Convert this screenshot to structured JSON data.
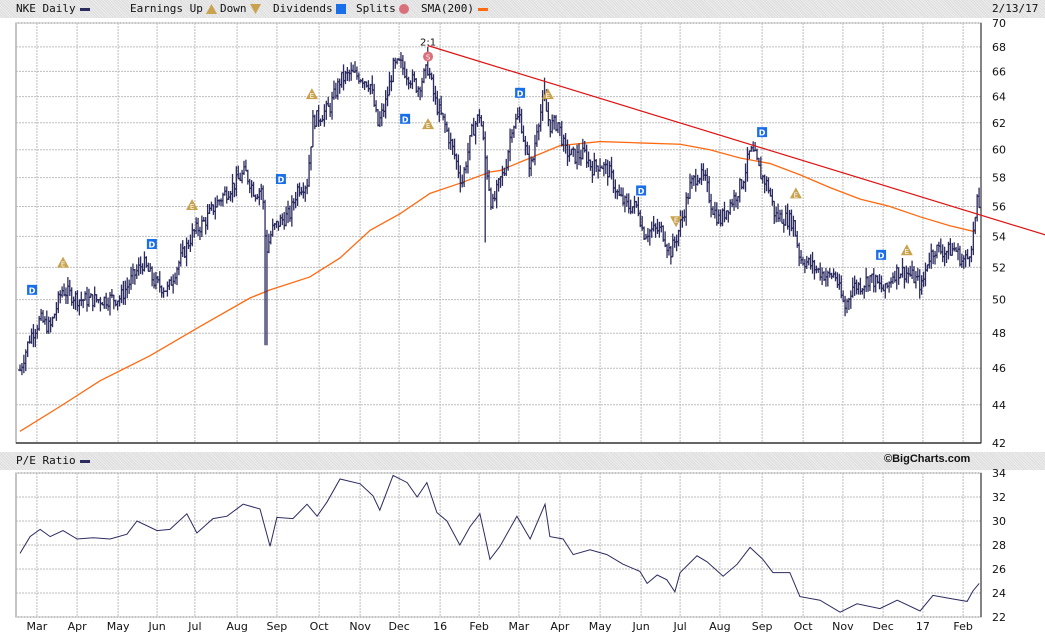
{
  "header": {
    "symbol_label": "NKE Daily",
    "earnings_label": "Earnings Up",
    "down_label": "Down",
    "dividends_label": "Dividends",
    "splits_label": "Splits",
    "sma_label": "SMA(200)",
    "date": "2/13/17"
  },
  "pe_header": {
    "label": "P/E Ratio",
    "brand": "©BigCharts.com"
  },
  "colors": {
    "price": "#2b2b60",
    "sma": "#ff6a10",
    "trend": "#e01010",
    "dividend": "#1a6ee8",
    "earnings": "#c9a24e",
    "split": "#d9707a",
    "grid": "#bdbdbd"
  },
  "chart_data": [
    {
      "type": "line",
      "title": "NKE Daily",
      "x_unit": "months since 2/13/15",
      "yscale": "log",
      "ylim": [
        42,
        70
      ],
      "yticks": [
        "42",
        "44",
        "46",
        "48",
        "50",
        "52",
        "54",
        "56",
        "58",
        "60",
        "62",
        "64",
        "66",
        "68",
        "70"
      ],
      "xticks": [
        {
          "t": 0.52,
          "label": "Mar"
        },
        {
          "t": 1.52,
          "label": "Apr"
        },
        {
          "t": 2.54,
          "label": "May"
        },
        {
          "t": 3.51,
          "label": "Jun"
        },
        {
          "t": 4.45,
          "label": "Jul"
        },
        {
          "t": 5.5,
          "label": "Aug"
        },
        {
          "t": 6.49,
          "label": "Sep"
        },
        {
          "t": 7.54,
          "label": "Oct"
        },
        {
          "t": 8.56,
          "label": "Nov"
        },
        {
          "t": 9.53,
          "label": "Dec"
        },
        {
          "t": 10.55,
          "label": "16"
        },
        {
          "t": 11.52,
          "label": "Feb"
        },
        {
          "t": 12.51,
          "label": "Mar"
        },
        {
          "t": 13.53,
          "label": "Apr"
        },
        {
          "t": 14.53,
          "label": "May"
        },
        {
          "t": 15.55,
          "label": "Jun"
        },
        {
          "t": 16.52,
          "label": "Jul"
        },
        {
          "t": 17.51,
          "label": "Aug"
        },
        {
          "t": 18.56,
          "label": "Sep"
        },
        {
          "t": 19.58,
          "label": "Oct"
        },
        {
          "t": 20.57,
          "label": "Nov"
        },
        {
          "t": 21.57,
          "label": "Dec"
        },
        {
          "t": 22.56,
          "label": "17"
        },
        {
          "t": 23.56,
          "label": "Feb"
        }
      ],
      "grid": true,
      "series_price_close": [
        [
          0.1,
          45.9
        ],
        [
          0.35,
          47.8
        ],
        [
          0.6,
          48.8
        ],
        [
          0.85,
          48.3
        ],
        [
          1.14,
          50.6
        ],
        [
          1.59,
          50.0
        ],
        [
          2.09,
          50.0
        ],
        [
          2.59,
          50.1
        ],
        [
          2.91,
          51.4
        ],
        [
          3.16,
          52.3
        ],
        [
          3.46,
          51.0
        ],
        [
          3.78,
          50.6
        ],
        [
          3.96,
          51.8
        ],
        [
          4.2,
          53.1
        ],
        [
          4.4,
          54.2
        ],
        [
          4.7,
          55.0
        ],
        [
          4.95,
          56.1
        ],
        [
          5.2,
          56.9
        ],
        [
          5.45,
          57.6
        ],
        [
          5.7,
          58.4
        ],
        [
          5.95,
          56.9
        ],
        [
          6.12,
          57.3
        ],
        [
          6.22,
          53.0
        ],
        [
          6.37,
          54.4
        ],
        [
          6.57,
          55.0
        ],
        [
          6.82,
          55.5
        ],
        [
          7.01,
          57.3
        ],
        [
          7.24,
          57.6
        ],
        [
          7.39,
          62.2
        ],
        [
          7.56,
          62.5
        ],
        [
          7.81,
          63.2
        ],
        [
          8.06,
          65.3
        ],
        [
          8.31,
          65.8
        ],
        [
          8.56,
          65.6
        ],
        [
          8.81,
          65.0
        ],
        [
          9.0,
          61.8
        ],
        [
          9.18,
          63.3
        ],
        [
          9.38,
          66.3
        ],
        [
          9.55,
          66.6
        ],
        [
          9.75,
          65.7
        ],
        [
          10.0,
          64.7
        ],
        [
          10.25,
          66.3
        ],
        [
          10.42,
          63.7
        ],
        [
          10.67,
          61.8
        ],
        [
          10.92,
          59.5
        ],
        [
          11.09,
          57.6
        ],
        [
          11.34,
          61.3
        ],
        [
          11.54,
          62.7
        ],
        [
          11.67,
          59.4
        ],
        [
          11.84,
          55.9
        ],
        [
          12.04,
          57.8
        ],
        [
          12.16,
          58.5
        ],
        [
          12.34,
          61.8
        ],
        [
          12.54,
          62.5
        ],
        [
          12.71,
          59.3
        ],
        [
          12.84,
          58.8
        ],
        [
          12.96,
          61.8
        ],
        [
          13.13,
          63.7
        ],
        [
          13.28,
          61.8
        ],
        [
          13.48,
          62.0
        ],
        [
          13.66,
          59.9
        ],
        [
          13.91,
          59.5
        ],
        [
          14.15,
          59.7
        ],
        [
          14.33,
          58.7
        ],
        [
          14.53,
          59.0
        ],
        [
          14.78,
          58.3
        ],
        [
          14.98,
          56.7
        ],
        [
          15.22,
          56.0
        ],
        [
          15.47,
          56.0
        ],
        [
          15.6,
          54.2
        ],
        [
          15.82,
          54.4
        ],
        [
          16.07,
          54.4
        ],
        [
          16.27,
          52.9
        ],
        [
          16.44,
          54.0
        ],
        [
          16.59,
          55.4
        ],
        [
          16.77,
          57.4
        ],
        [
          16.97,
          58.3
        ],
        [
          17.14,
          57.8
        ],
        [
          17.31,
          56.0
        ],
        [
          17.51,
          55.0
        ],
        [
          17.71,
          56.0
        ],
        [
          17.89,
          56.7
        ],
        [
          18.08,
          57.8
        ],
        [
          18.26,
          59.9
        ],
        [
          18.38,
          59.5
        ],
        [
          18.51,
          58.3
        ],
        [
          18.71,
          57.4
        ],
        [
          18.88,
          55.4
        ],
        [
          19.13,
          55.2
        ],
        [
          19.33,
          55.0
        ],
        [
          19.5,
          52.6
        ],
        [
          19.7,
          52.3
        ],
        [
          19.95,
          51.8
        ],
        [
          20.2,
          51.4
        ],
        [
          20.37,
          51.6
        ],
        [
          20.5,
          50.4
        ],
        [
          20.62,
          49.5
        ],
        [
          20.8,
          50.8
        ],
        [
          21.04,
          50.9
        ],
        [
          21.24,
          51.4
        ],
        [
          21.49,
          50.8
        ],
        [
          21.62,
          50.5
        ],
        [
          21.82,
          51.6
        ],
        [
          21.99,
          51.8
        ],
        [
          22.19,
          51.6
        ],
        [
          22.36,
          51.3
        ],
        [
          22.54,
          50.8
        ],
        [
          22.69,
          52.6
        ],
        [
          22.86,
          53.2
        ],
        [
          23.11,
          53.0
        ],
        [
          23.36,
          53.2
        ],
        [
          23.53,
          52.4
        ],
        [
          23.68,
          52.6
        ],
        [
          23.81,
          54.1
        ],
        [
          23.91,
          56.2
        ],
        [
          23.98,
          55.9
        ]
      ],
      "price_extremes": [
        {
          "t": 6.22,
          "low": 47.3
        },
        {
          "t": 10.25,
          "high": 68.0
        },
        {
          "t": 11.67,
          "low": 53.6
        },
        {
          "t": 13.13,
          "high": 65.5
        },
        {
          "t": 20.62,
          "low": 49.0
        }
      ],
      "series_sma200": [
        [
          0.1,
          42.6
        ],
        [
          1.09,
          43.9
        ],
        [
          2.09,
          45.3
        ],
        [
          3.33,
          46.7
        ],
        [
          4.58,
          48.4
        ],
        [
          5.82,
          50.1
        ],
        [
          6.32,
          50.6
        ],
        [
          7.31,
          51.4
        ],
        [
          8.06,
          52.6
        ],
        [
          8.81,
          54.4
        ],
        [
          9.55,
          55.5
        ],
        [
          10.3,
          56.9
        ],
        [
          11.04,
          57.6
        ],
        [
          11.79,
          58.4
        ],
        [
          12.04,
          58.5
        ],
        [
          12.79,
          59.4
        ],
        [
          13.53,
          60.3
        ],
        [
          14.53,
          60.6
        ],
        [
          15.52,
          60.5
        ],
        [
          16.52,
          60.4
        ],
        [
          17.26,
          60.0
        ],
        [
          18.01,
          59.4
        ],
        [
          18.76,
          59.0
        ],
        [
          19.5,
          58.2
        ],
        [
          20.25,
          57.3
        ],
        [
          21.0,
          56.5
        ],
        [
          21.74,
          56.0
        ],
        [
          22.49,
          55.3
        ],
        [
          23.23,
          54.7
        ],
        [
          23.86,
          54.3
        ]
      ],
      "trendline": {
        "start": {
          "t": 10.25,
          "price": 68.1
        },
        "end": {
          "t": 25.6,
          "price": 54.1
        }
      },
      "dividends": [
        {
          "t": 0.4,
          "price": 50.6
        },
        {
          "t": 3.38,
          "price": 53.5
        },
        {
          "t": 6.59,
          "price": 57.9
        },
        {
          "t": 9.68,
          "price": 62.3
        },
        {
          "t": 12.54,
          "price": 64.3
        },
        {
          "t": 15.55,
          "price": 57.1
        },
        {
          "t": 18.56,
          "price": 61.3
        },
        {
          "t": 21.52,
          "price": 52.8
        }
      ],
      "earnings_up": [
        {
          "t": 1.17,
          "price": 52.3
        },
        {
          "t": 4.38,
          "price": 56.1
        },
        {
          "t": 7.36,
          "price": 64.2
        },
        {
          "t": 10.25,
          "price": 61.9
        },
        {
          "t": 13.23,
          "price": 64.2
        },
        {
          "t": 19.4,
          "price": 56.9
        },
        {
          "t": 22.16,
          "price": 53.1
        }
      ],
      "earnings_down": [
        {
          "t": 16.42,
          "price": 55.0
        }
      ],
      "splits": [
        {
          "t": 10.25,
          "price": 67.2,
          "label": "2:1"
        }
      ],
      "marker_glyphs": {
        "dividend": "D",
        "earnings": "E",
        "split": "S"
      }
    },
    {
      "type": "line",
      "title": "P/E Ratio",
      "ylim": [
        22,
        34
      ],
      "yticks": [
        "22",
        "24",
        "26",
        "28",
        "30",
        "32",
        "34"
      ],
      "grid": true,
      "series_pe": [
        [
          0.1,
          27.3
        ],
        [
          0.35,
          28.7
        ],
        [
          0.6,
          29.3
        ],
        [
          0.85,
          28.7
        ],
        [
          1.17,
          29.2
        ],
        [
          1.52,
          28.5
        ],
        [
          1.92,
          28.6
        ],
        [
          2.34,
          28.5
        ],
        [
          2.76,
          28.9
        ],
        [
          3.01,
          30.0
        ],
        [
          3.51,
          29.2
        ],
        [
          3.83,
          29.3
        ],
        [
          4.25,
          30.6
        ],
        [
          4.5,
          29.0
        ],
        [
          4.9,
          30.2
        ],
        [
          5.25,
          30.4
        ],
        [
          5.65,
          31.4
        ],
        [
          6.07,
          31.0
        ],
        [
          6.32,
          27.9
        ],
        [
          6.49,
          30.3
        ],
        [
          6.89,
          30.2
        ],
        [
          7.24,
          31.4
        ],
        [
          7.49,
          30.4
        ],
        [
          7.74,
          31.6
        ],
        [
          8.06,
          33.5
        ],
        [
          8.56,
          33.1
        ],
        [
          8.88,
          32.1
        ],
        [
          9.05,
          30.9
        ],
        [
          9.38,
          33.8
        ],
        [
          9.73,
          33.2
        ],
        [
          9.98,
          32.0
        ],
        [
          10.22,
          33.2
        ],
        [
          10.47,
          30.7
        ],
        [
          10.72,
          30.0
        ],
        [
          11.04,
          28.0
        ],
        [
          11.29,
          29.5
        ],
        [
          11.54,
          30.6
        ],
        [
          11.79,
          26.8
        ],
        [
          12.04,
          27.9
        ],
        [
          12.46,
          30.4
        ],
        [
          12.79,
          28.5
        ],
        [
          13.16,
          31.4
        ],
        [
          13.28,
          28.7
        ],
        [
          13.61,
          28.5
        ],
        [
          13.86,
          27.2
        ],
        [
          14.28,
          27.6
        ],
        [
          14.7,
          27.2
        ],
        [
          15.1,
          26.4
        ],
        [
          15.52,
          25.8
        ],
        [
          15.7,
          24.8
        ],
        [
          15.95,
          25.5
        ],
        [
          16.19,
          25.1
        ],
        [
          16.39,
          24.1
        ],
        [
          16.52,
          25.7
        ],
        [
          16.94,
          27.1
        ],
        [
          17.19,
          26.6
        ],
        [
          17.59,
          25.4
        ],
        [
          17.94,
          26.4
        ],
        [
          18.26,
          27.8
        ],
        [
          18.58,
          26.8
        ],
        [
          18.83,
          25.7
        ],
        [
          19.25,
          25.7
        ],
        [
          19.5,
          23.7
        ],
        [
          20.0,
          23.4
        ],
        [
          20.5,
          22.4
        ],
        [
          20.92,
          23.1
        ],
        [
          21.49,
          22.7
        ],
        [
          21.92,
          23.4
        ],
        [
          22.49,
          22.5
        ],
        [
          22.81,
          23.8
        ],
        [
          23.31,
          23.5
        ],
        [
          23.66,
          23.3
        ],
        [
          23.81,
          24.2
        ],
        [
          23.96,
          24.8
        ]
      ]
    }
  ]
}
